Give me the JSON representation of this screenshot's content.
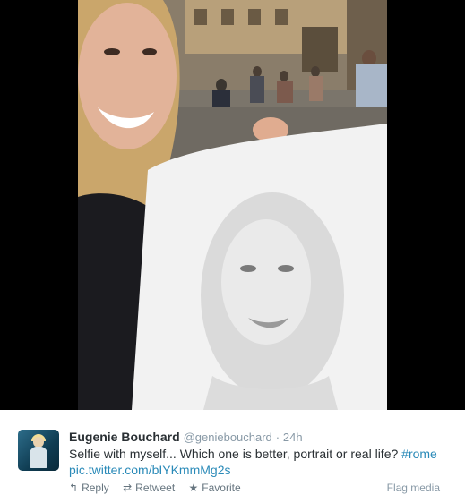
{
  "media": {
    "image_alt": "",
    "colors": {
      "letterbox": "#000000",
      "paper": "#f2f2f2",
      "sketch": "#9a9a9a"
    }
  },
  "tweet": {
    "display_name": "Eugenie Bouchard",
    "handle": "@geniebouchard",
    "separator": "·",
    "timestamp": "24h",
    "text_main": "Selfie with myself... Which one is better, portrait or real life?",
    "hashtag": "#rome",
    "link": "pic.twitter.com/bIYKmmMg2s",
    "actions": {
      "reply": {
        "icon": "reply-arrow-icon",
        "label": "Reply"
      },
      "retweet": {
        "icon": "retweet-icon",
        "label": "Retweet"
      },
      "favorite": {
        "icon": "star-icon",
        "label": "Favorite"
      }
    },
    "flag_label": "Flag media"
  }
}
